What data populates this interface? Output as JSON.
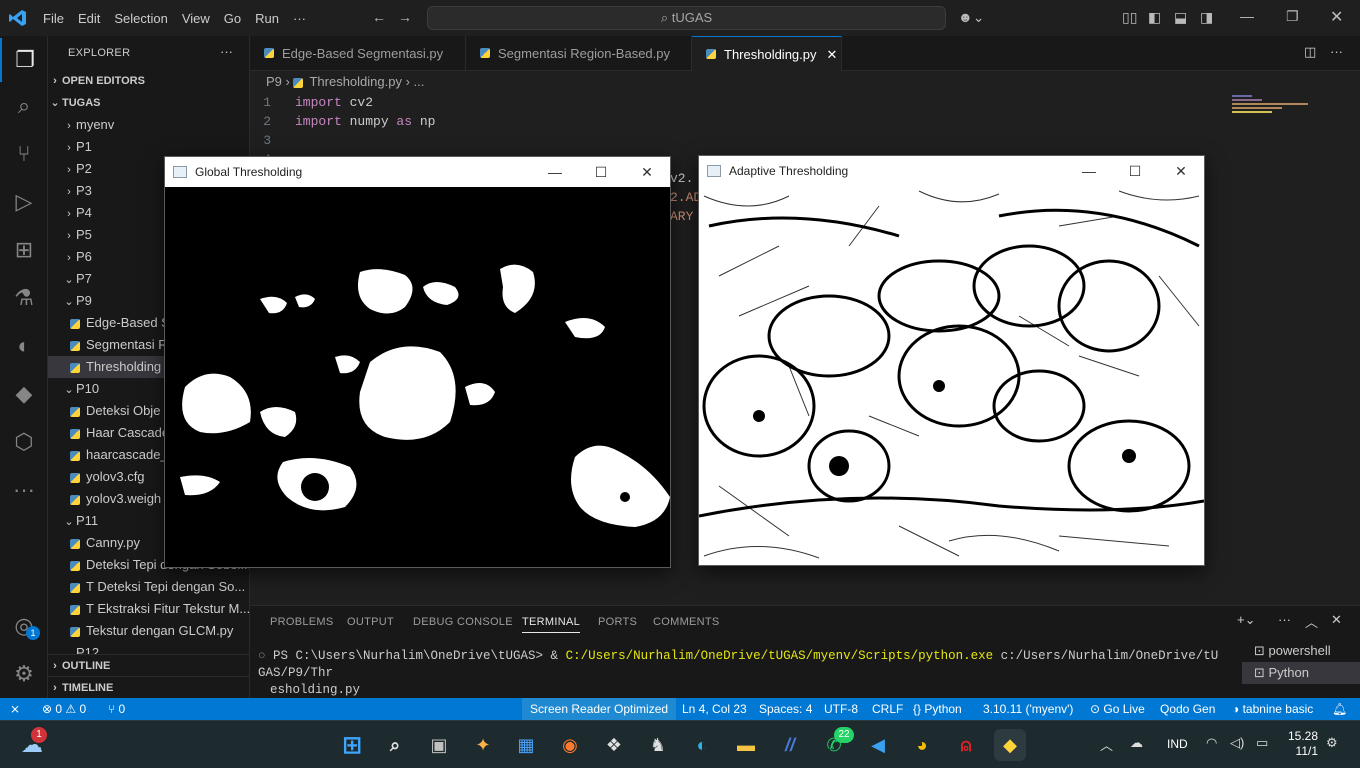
{
  "titlebar": {
    "menu": [
      "File",
      "Edit",
      "Selection",
      "View",
      "Go",
      "Run",
      "···"
    ],
    "search": "tUGAS"
  },
  "sidebar": {
    "title": "EXPLORER",
    "sections": {
      "open_editors": "OPEN EDITORS",
      "workspace": "TUGAS",
      "outline": "OUTLINE",
      "timeline": "TIMELINE"
    },
    "items": [
      {
        "label": "myenv",
        "type": "folder",
        "expanded": false
      },
      {
        "label": "P1",
        "type": "folder",
        "expanded": false
      },
      {
        "label": "P2",
        "type": "folder",
        "expanded": false
      },
      {
        "label": "P3",
        "type": "folder",
        "expanded": false
      },
      {
        "label": "P4",
        "type": "folder",
        "expanded": false
      },
      {
        "label": "P5",
        "type": "folder",
        "expanded": false
      },
      {
        "label": "P6",
        "type": "folder",
        "expanded": false
      },
      {
        "label": "P7",
        "type": "folder",
        "expanded": true
      },
      {
        "label": "P9",
        "type": "folder",
        "expanded": true
      },
      {
        "label": "Edge-Based S",
        "type": "file"
      },
      {
        "label": "Segmentasi R",
        "type": "file"
      },
      {
        "label": "Thresholding",
        "type": "file",
        "selected": true
      },
      {
        "label": "P10",
        "type": "folder",
        "expanded": true
      },
      {
        "label": "Deteksi Obje",
        "type": "file"
      },
      {
        "label": "Haar Cascade",
        "type": "file"
      },
      {
        "label": "haarcascade_",
        "type": "file"
      },
      {
        "label": "yolov3.cfg",
        "type": "file"
      },
      {
        "label": "yolov3.weigh",
        "type": "file"
      },
      {
        "label": "P11",
        "type": "folder",
        "expanded": true
      },
      {
        "label": "Canny.py",
        "type": "file"
      },
      {
        "label": "Deteksi Tepi dengan Sobel...",
        "type": "file"
      },
      {
        "label": "T Deteksi Tepi dengan So...",
        "type": "file"
      },
      {
        "label": "T Ekstraksi Fitur Tekstur M...",
        "type": "file"
      },
      {
        "label": "Tekstur dengan GLCM.py",
        "type": "file"
      },
      {
        "label": "P12",
        "type": "folder",
        "expanded": true
      }
    ]
  },
  "tabs": [
    {
      "label": "Edge-Based Segmentasi.py",
      "active": false
    },
    {
      "label": "Segmentasi Region-Based.py",
      "active": false
    },
    {
      "label": "Thresholding.py",
      "active": true
    }
  ],
  "breadcrumb": [
    "P9",
    "Thresholding.py",
    "..."
  ],
  "editor": {
    "lines": [
      {
        "n": "1",
        "kw": "import",
        "rest": " cv2"
      },
      {
        "n": "2",
        "kw": "import",
        "rest": " numpy ",
        "kw2": "as",
        "rest2": " np"
      },
      {
        "n": "3",
        "kw": "",
        "rest": ""
      },
      {
        "n": "4",
        "kw": "",
        "rest": ""
      }
    ],
    "peek": [
      "v2.",
      "2.AD",
      "ARY"
    ]
  },
  "windows": {
    "global": {
      "title": "Global Thresholding"
    },
    "adaptive": {
      "title": "Adaptive Thresholding"
    }
  },
  "panel": {
    "tabs": [
      "PROBLEMS",
      "OUTPUT",
      "DEBUG CONSOLE",
      "TERMINAL",
      "PORTS",
      "COMMENTS"
    ],
    "active_tab": "TERMINAL",
    "terminal_prompt": "PS C:\\Users\\Nurhalim\\OneDrive\\tUGAS> & ",
    "terminal_exe": "C:/Users/Nurhalim/OneDrive/tUGAS/myenv/Scripts/python.exe",
    "terminal_arg": " c:/Users/Nurhalim/OneDrive/tUGAS/P9/Thr",
    "terminal_wrap": "esholding.py",
    "shells": [
      "powershell",
      "Python"
    ]
  },
  "status": {
    "remote": "⨯",
    "problems": "⊗ 0 ⚠ 0",
    "ports": "⑂ 0",
    "screen_reader": "Screen Reader Optimized",
    "position": "Ln 4, Col 23",
    "spaces": "Spaces: 4",
    "encoding": "UTF-8",
    "eol": "CRLF",
    "language": "{} Python",
    "interpreter": "3.10.11 ('myenv')",
    "golive": "Go Live",
    "qodo": "Qodo Gen",
    "tabnine": "tabnine basic"
  },
  "taskbar": {
    "weather_badge": "1",
    "whatsapp_badge": "22",
    "lang": "IND",
    "time": "15.28",
    "date": "11/1",
    "accounts_badge": "1"
  },
  "colors": {
    "accent": "#0078d4",
    "status_bar": "#0078d4",
    "editor_bg": "#1f1f1f",
    "taskbar": "#1d2a2e"
  }
}
